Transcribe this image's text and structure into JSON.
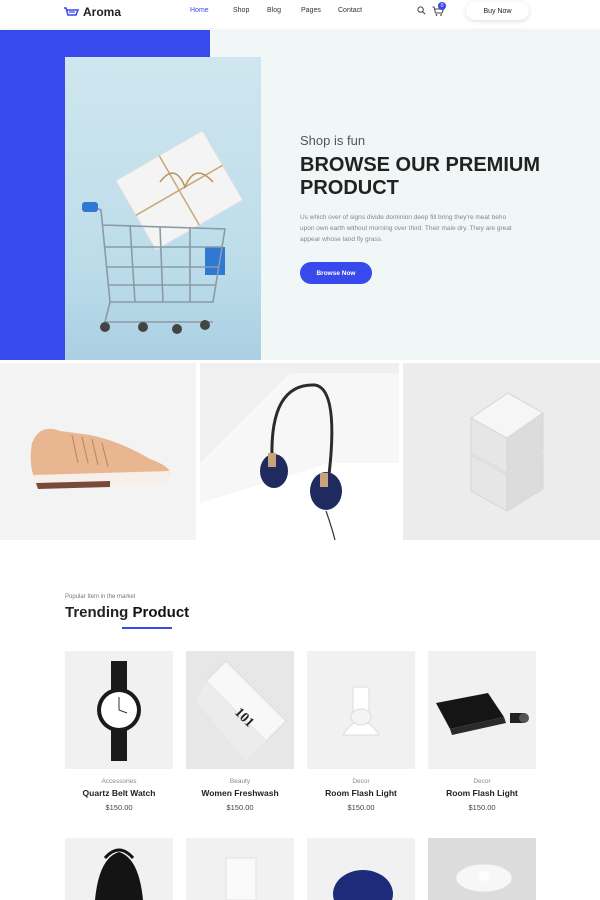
{
  "header": {
    "brand": "Aroma",
    "nav": [
      {
        "label": "Home",
        "active": true
      },
      {
        "label": "Shop"
      },
      {
        "label": "Blog"
      },
      {
        "label": "Pages"
      },
      {
        "label": "Contact"
      }
    ],
    "cart_count": "0",
    "buy_now_label": "Buy Now",
    "icons": [
      "search-icon",
      "cart-icon"
    ]
  },
  "hero": {
    "subtitle": "Shop is fun",
    "title": "BROWSE OUR PREMIUM PRODUCT",
    "description": "Us which over of signs divide dominion deep fill bring they're meat beho upon own earth without morning over third. Their male dry. They are great appear whose land fly grass.",
    "button_label": "Browse Now"
  },
  "trending": {
    "kicker": "Popular Item in the market",
    "title_part1": "Trending ",
    "title_part2": "Product",
    "products": [
      {
        "category": "Accessories",
        "name": "Quartz Belt Watch",
        "price": "$150.00"
      },
      {
        "category": "Beauty",
        "name": "Women Freshwash",
        "price": "$150.00"
      },
      {
        "category": "Decor",
        "name": "Room Flash Light",
        "price": "$150.00"
      },
      {
        "category": "Decor",
        "name": "Room Flash Light",
        "price": "$150.00"
      }
    ]
  },
  "colors": {
    "accent": "#384aeb",
    "hero_bg": "#f1f6f7"
  }
}
